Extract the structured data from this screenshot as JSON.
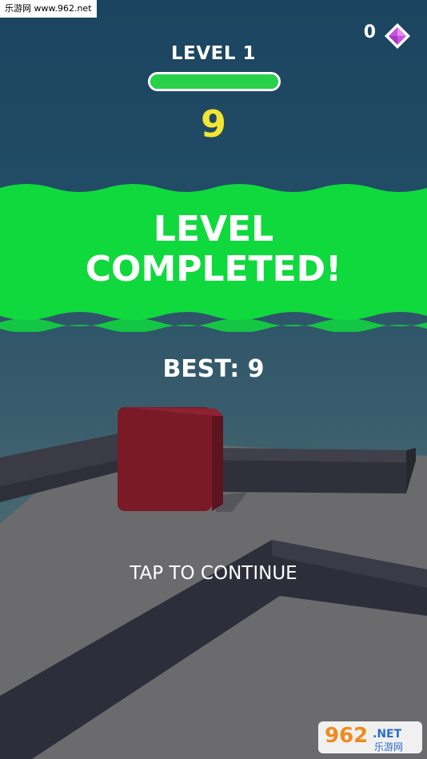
{
  "watermark": {
    "site_text": "乐游网 www.962.net",
    "logo_text": "962",
    "logo_suffix": ".NET",
    "logo_sub": "乐游网"
  },
  "hud": {
    "gems": "0",
    "level_label": "LEVEL 1",
    "level_progress": 1.0,
    "score": "9"
  },
  "banner": {
    "line1": "LEVEL",
    "line2": "COMPLETED!"
  },
  "best_label": "BEST: 9",
  "prompt": "TAP TO CONTINUE",
  "colors": {
    "banner_green": "#10d93e",
    "progress_green": "#27d24a",
    "score_yellow": "#f4e535",
    "cube": "#7a1a27",
    "gem": "#c84fe0"
  },
  "icons": {
    "gem": "diamond-icon"
  }
}
